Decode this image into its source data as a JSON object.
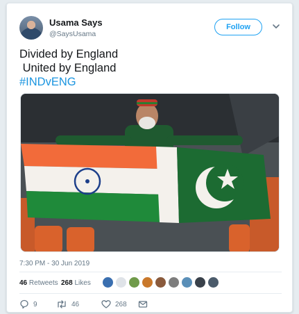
{
  "tweet": {
    "author_name": "Usama Says",
    "author_handle": "@SaysUsama",
    "follow_label": "Follow",
    "text_line1": "Divided by England",
    "text_line2": " United by England",
    "hashtag": "#INDvENG",
    "timestamp": "7:30 PM - 30 Jun 2019",
    "retweets_count": "46",
    "retweets_label": "Retweets",
    "likes_count": "268",
    "likes_label": "Likes",
    "actions": {
      "reply_count": "9",
      "retweet_count": "46",
      "like_count": "268"
    }
  },
  "colors": {
    "accent": "#1da1f2",
    "hashtag": "#1b95e0",
    "muted": "#657786",
    "india_saffron": "#f26b3a",
    "india_green": "#1f8a3a",
    "pakistan_green": "#1c6b32"
  },
  "likers": [
    {
      "color": "#3a6fb0"
    },
    {
      "color": "#dfe3e8"
    },
    {
      "color": "#6f9a4a"
    },
    {
      "color": "#c9782b"
    },
    {
      "color": "#8a5a3c"
    },
    {
      "color": "#7d7d7d"
    },
    {
      "color": "#5a8fb8"
    },
    {
      "color": "#39414a"
    },
    {
      "color": "#4b5b6b"
    }
  ]
}
